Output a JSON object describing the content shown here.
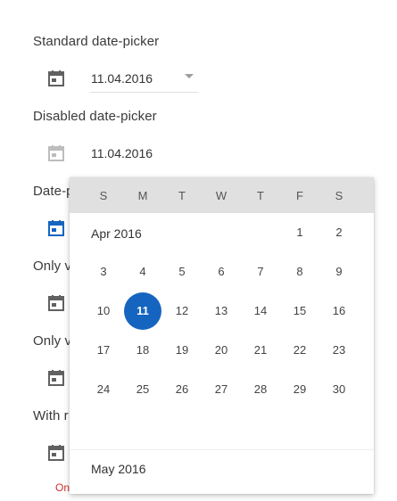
{
  "sections": [
    {
      "label": "Standard date-picker",
      "value": "11.04.2016"
    },
    {
      "label": "Disabled date-picker",
      "value": "11.04.2016"
    },
    {
      "label": "Date-p"
    },
    {
      "label": "Only v"
    },
    {
      "label": "Only v"
    },
    {
      "label": "With r"
    }
  ],
  "error_text": "On",
  "calendar": {
    "weekdays": [
      "S",
      "M",
      "T",
      "W",
      "T",
      "F",
      "S"
    ],
    "month_title": "Apr 2016",
    "next_month_title": "May 2016",
    "first_row": [
      "1",
      "2"
    ],
    "weeks": [
      [
        "3",
        "4",
        "5",
        "6",
        "7",
        "8",
        "9"
      ],
      [
        "10",
        "11",
        "12",
        "13",
        "14",
        "15",
        "16"
      ],
      [
        "17",
        "18",
        "19",
        "20",
        "21",
        "22",
        "23"
      ],
      [
        "24",
        "25",
        "26",
        "27",
        "28",
        "29",
        "30"
      ]
    ],
    "selected_day": "11"
  },
  "colors": {
    "accent": "#1565c0",
    "icon_default": "#616161",
    "icon_disabled": "#bdbdbd",
    "error": "#d32f2f",
    "weekday_header_bg": "#e0e0e0"
  }
}
